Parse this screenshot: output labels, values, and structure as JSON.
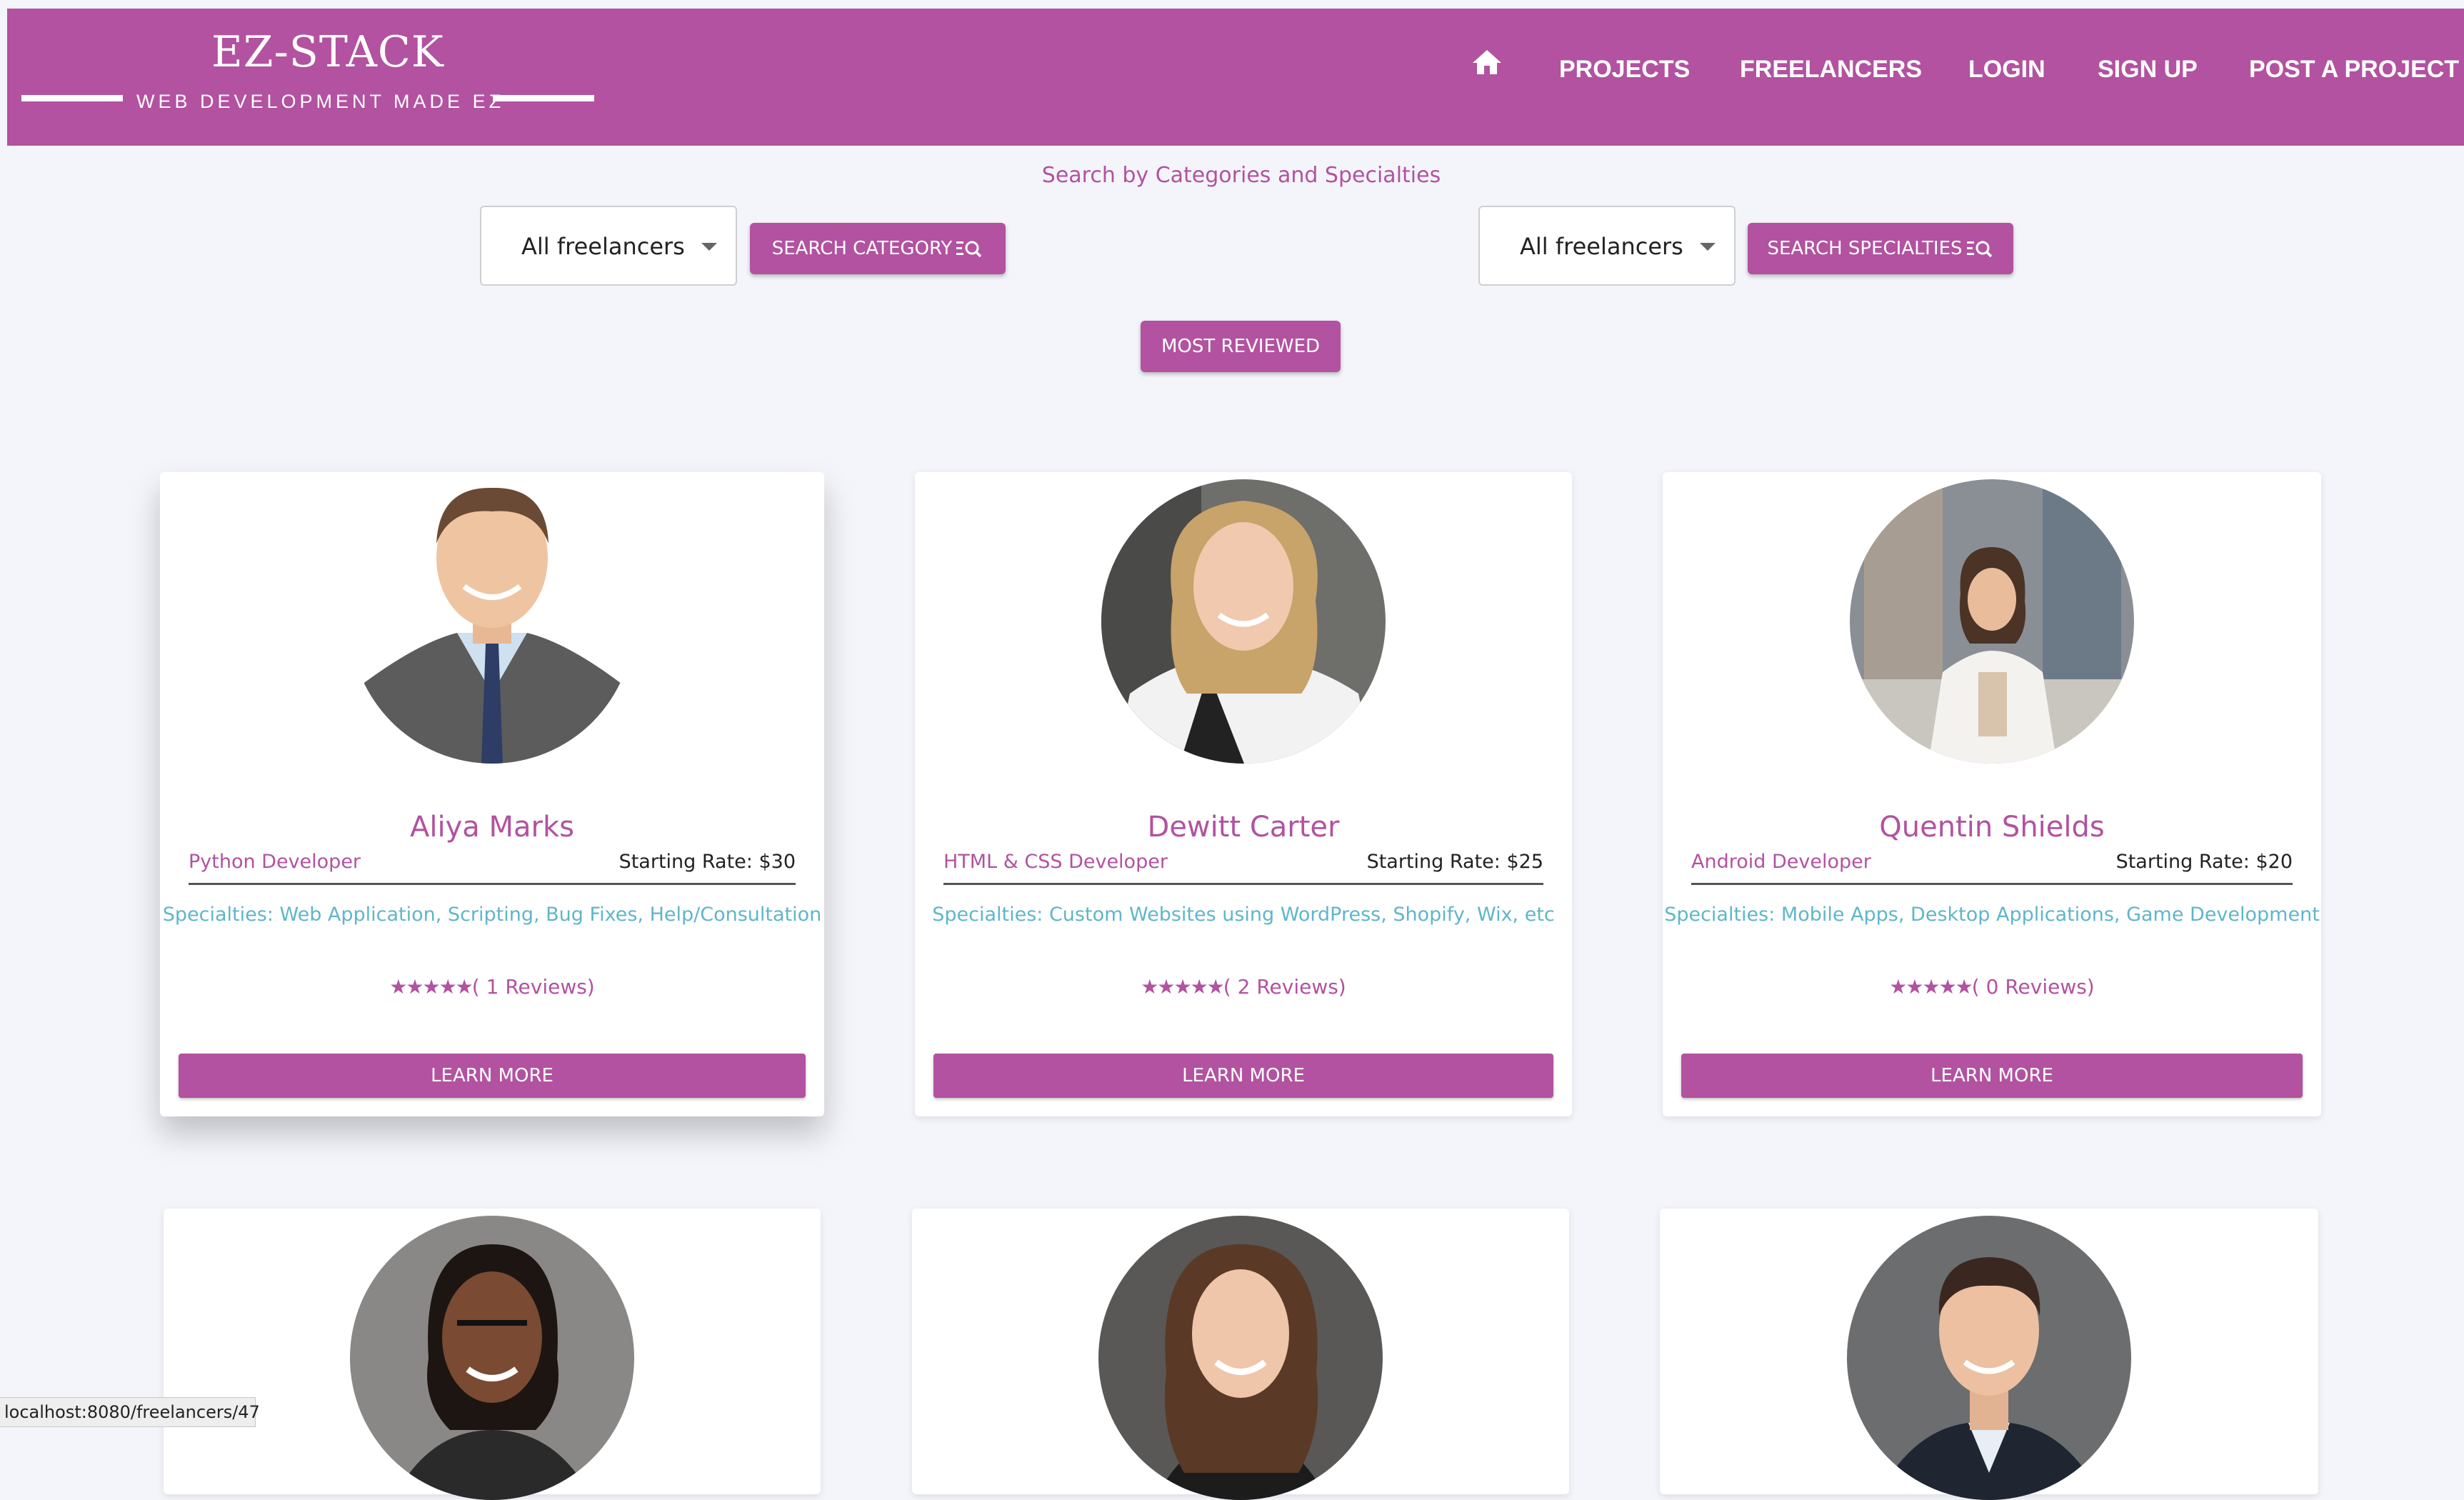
{
  "brand": {
    "title": "EZ-STACK",
    "tagline": "WEB DEVELOPMENT MADE EZ"
  },
  "nav": {
    "home_icon": "home-icon",
    "items": [
      "PROJECTS",
      "FREELANCERS",
      "LOGIN",
      "SIGN UP",
      "POST A PROJECT"
    ]
  },
  "search": {
    "heading": "Search by Categories and Specialties",
    "category_select_value": "All freelancers",
    "category_button": "SEARCH CATEGORY",
    "specialty_select_value": "All freelancers",
    "specialty_button": "SEARCH SPECIALTIES",
    "button_icon": "search-list-icon",
    "most_reviewed": "MOST REVIEWED"
  },
  "cards": [
    {
      "name": "Aliya Marks",
      "role": "Python Developer",
      "rate": "Starting Rate: $30",
      "specialties": "Specialties: Web Application, Scripting, Bug Fixes, Help/Consultation",
      "stars": "★★★★★",
      "reviews": "( 1 Reviews)",
      "button": "LEARN MORE"
    },
    {
      "name": "Dewitt Carter",
      "role": "HTML & CSS Developer",
      "rate": "Starting Rate: $25",
      "specialties": "Specialties: Custom Websites using WordPress, Shopify, Wix, etc",
      "stars": "★★★★★",
      "reviews": "( 2 Reviews)",
      "button": "LEARN MORE"
    },
    {
      "name": "Quentin Shields",
      "role": "Android Developer",
      "rate": "Starting Rate: $20",
      "specialties": "Specialties: Mobile Apps, Desktop Applications, Game Development",
      "stars": "★★★★★",
      "reviews": "( 0 Reviews)",
      "button": "LEARN MORE"
    }
  ],
  "status_url": "localhost:8080/freelancers/47",
  "colors": {
    "brand": "#b252a0",
    "specialty": "#5fb6c9",
    "background": "#f4f5fb"
  }
}
